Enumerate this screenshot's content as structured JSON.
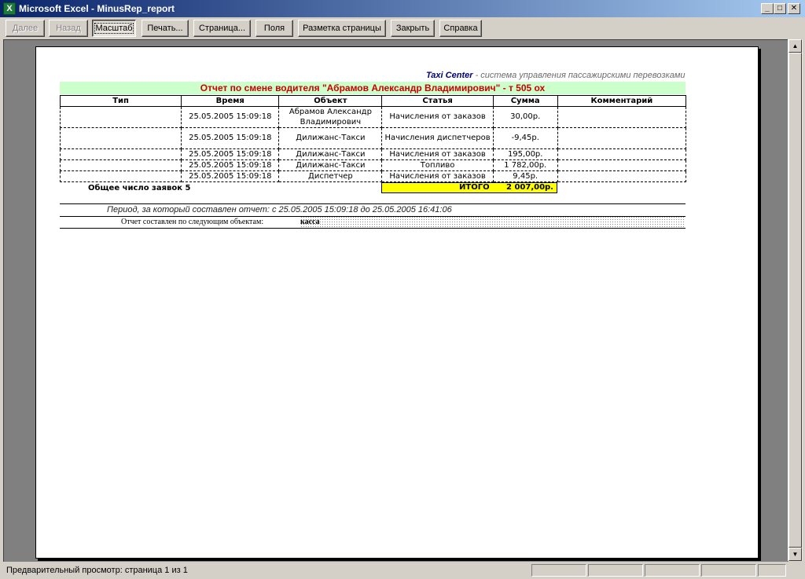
{
  "window": {
    "title": "Microsoft Excel - MinusRep_report",
    "app_icon": "X"
  },
  "toolbar": {
    "next": "Далее",
    "prev": "Назад",
    "zoom": "Масштаб",
    "print": "Печать...",
    "setup": "Страница...",
    "margins": "Поля",
    "page_break": "Разметка страницы",
    "close": "Закрыть",
    "help": "Справка"
  },
  "report": {
    "company_brand": "Taxi Center",
    "company_tagline": " - система управления пассажирскими перевозками",
    "title": "Отчет по смене водителя \"Абрамов Александр Владимирович\" - т 505 ох",
    "columns": [
      "Тип",
      "Время",
      "Объект",
      "Статья",
      "Сумма",
      "Комментарий"
    ],
    "rows": [
      {
        "type": "",
        "time": "25.05.2005 15:09:18",
        "object": "Абрамов Александр Владимирович",
        "article": "Начисления от заказов",
        "sum": "30,00р.",
        "comment": ""
      },
      {
        "type": "",
        "time": "25.05.2005 15:09:18",
        "object": "Дилижанс-Такси",
        "article": "Начисления диспетчеров",
        "sum": "-9,45р.",
        "comment": ""
      },
      {
        "type": "",
        "time": "25.05.2005 15:09:18",
        "object": "Дилижанс-Такси",
        "article": "Начисления от заказов",
        "sum": "195,00р.",
        "comment": ""
      },
      {
        "type": "",
        "time": "25.05.2005 15:09:18",
        "object": "Дилижанс-Такси",
        "article": "Топливо",
        "sum": "1 782,00р.",
        "comment": ""
      },
      {
        "type": "",
        "time": "25.05.2005 15:09:18",
        "object": "Диспетчер",
        "article": "Начисления от заказов",
        "sum": "9,45р.",
        "comment": ""
      }
    ],
    "total_count_label": "Общее число заявок  5",
    "total_label": "ИТОГО",
    "total_value": "2 007,00р.",
    "period": "Период, за который составлен отчет:  с 25.05.2005 15:09:18 до 25.05.2005 16:41:06",
    "objects_label": "Отчет составлен по следующим объектам:",
    "objects_value": "касса"
  },
  "status": {
    "text": "Предварительный просмотр: страница 1 из 1"
  }
}
